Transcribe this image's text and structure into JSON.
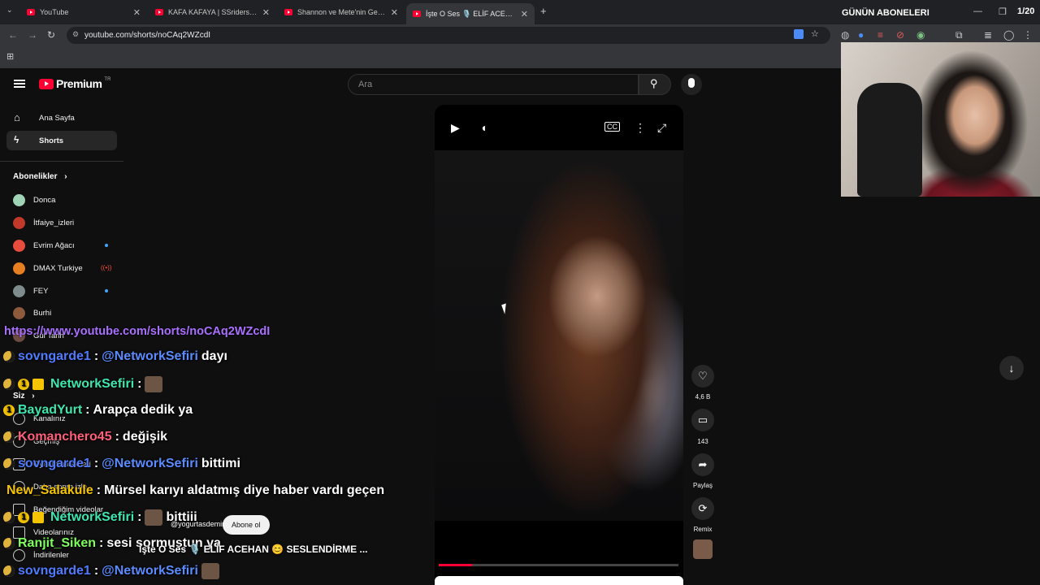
{
  "browser": {
    "tabs": [
      {
        "title": "YouTube"
      },
      {
        "title": "KAFA KAFAYA | SSriders | Motor"
      },
      {
        "title": "Shannon ve Mete'nin Gece Mac"
      },
      {
        "title": "İşte O Ses 🎙️ ELİF ACEHAN"
      }
    ],
    "url": "youtube.com/shorts/noCAq2WZcdI",
    "window_title": "GÜNÜN ABONELERI",
    "window_counter": "1/20"
  },
  "youtube": {
    "logo_text": "Premium",
    "logo_country": "TR",
    "search_placeholder": "Ara",
    "nav": [
      {
        "label": "Ana Sayfa"
      },
      {
        "label": "Shorts"
      }
    ],
    "subscriptions_title": "Abonelikler",
    "subscriptions": [
      {
        "name": "Donca",
        "color": "#9fd4b6",
        "dot": false,
        "live": false
      },
      {
        "name": "İtfaiye_izleri",
        "color": "#c0392b",
        "dot": false,
        "live": false
      },
      {
        "name": "Evrim Ağacı",
        "color": "#e74c3c",
        "dot": true,
        "live": false
      },
      {
        "name": "DMAX Turkiye",
        "color": "#e67e22",
        "dot": false,
        "live": true
      },
      {
        "name": "FEY",
        "color": "#7f8c8d",
        "dot": true,
        "live": false
      },
      {
        "name": "Burhi",
        "color": "#8e5a3c",
        "dot": false,
        "live": false
      },
      {
        "name": "Gül Tarih",
        "color": "#6d4c41",
        "dot": false,
        "live": false
      }
    ],
    "you_title": "Siz",
    "you_items": [
      {
        "label": "Kanalınız"
      },
      {
        "label": "Geçmiş"
      },
      {
        "label": "Oynatma listeleri"
      },
      {
        "label": "Daha sonra izle"
      },
      {
        "label": "Beğendiğim videolar"
      },
      {
        "label": "Videolarınız"
      },
      {
        "label": "İndirilenler"
      }
    ],
    "video": {
      "progress": 0.14,
      "channel": "@yogurtasdemir",
      "subscribe_label": "Abone ol",
      "caption": "İşte O Ses 🎙️ ELİF ACEHAN 😊 SESLENDİRME ..."
    },
    "actions": {
      "likes": "4,6 B",
      "comments": "143",
      "share": "Paylaş",
      "remix": "Remix"
    }
  },
  "chat": {
    "url": "https://www.youtube.com/shorts/noCAq2WZcdI",
    "messages": [
      {
        "user": "sovngarde1",
        "color": "#4f7cff",
        "mention": "@NetworkSefiri",
        "text": "dayı"
      },
      {
        "user": "NetworkSefiri",
        "color": "#3ee6b0",
        "mention": "",
        "text": ""
      },
      {
        "user": "BayadYurt",
        "color": "#3ee6b0",
        "mention": "",
        "text": "Arapça dedik ya"
      },
      {
        "user": "Komanchero45",
        "color": "#ff5f7a",
        "mention": "",
        "text": "değişik"
      },
      {
        "user": "sovngarde1",
        "color": "#4f7cff",
        "mention": "@NetworkSefiri",
        "text": "bittimi"
      },
      {
        "user": "New_Salakule",
        "color": "#f5c400",
        "mention": "",
        "text": "Mürsel karıyı aldatmış diye haber vardı geçen"
      },
      {
        "user": "NetworkSefiri",
        "color": "#3ee6b0",
        "mention": "",
        "text": "bittiii"
      },
      {
        "user": "Ranjit_Siken",
        "color": "#7dff5c",
        "mention": "",
        "text": "sesi sormuştun ya"
      },
      {
        "user": "sovngarde1",
        "color": "#4f7cff",
        "mention": "@NetworkSefiri",
        "text": ""
      }
    ]
  }
}
